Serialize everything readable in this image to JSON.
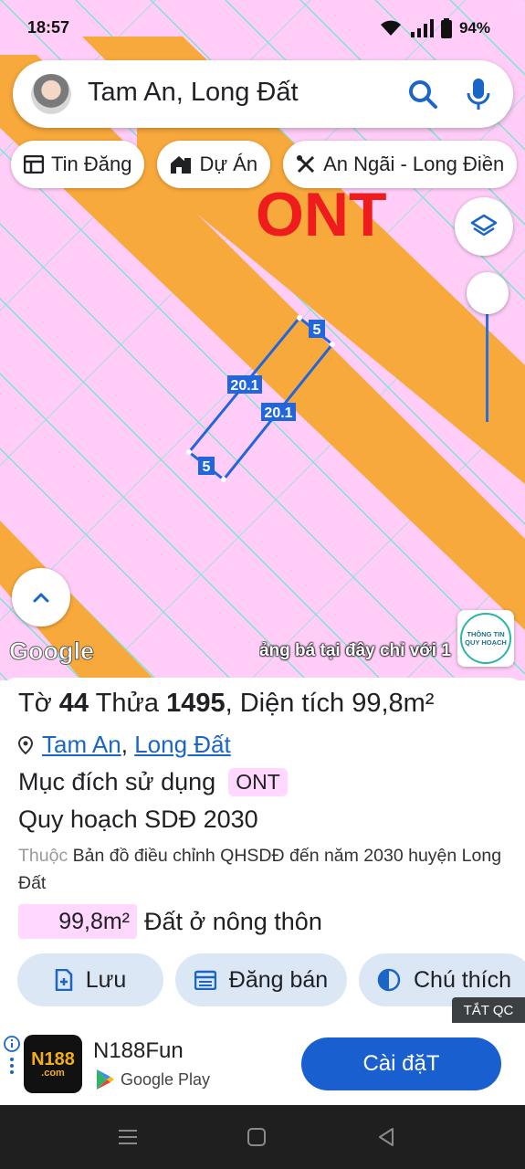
{
  "status_bar": {
    "time": "18:57",
    "battery": "94%"
  },
  "search": {
    "query": "Tam An, Long Đất"
  },
  "chips": [
    {
      "label": "Tin Đăng",
      "icon": "listing-icon"
    },
    {
      "label": "Dự Án",
      "icon": "project-icon"
    },
    {
      "label": "An Ngãi - Long Điền",
      "icon": "tools-icon"
    }
  ],
  "map": {
    "zone_label": "ONT",
    "parcel_edges": {
      "long_side_1": "20.1",
      "long_side_2": "20.1",
      "short_side_1": "5",
      "short_side_2": "5"
    },
    "attribution": "Google",
    "ad_ribbon": "ảng bá tại đây chỉ với 1",
    "planning_badge": "THÔNG TIN QUY HOẠCH",
    "colors": {
      "land": "#ffcdf7",
      "road": "#f8a93b",
      "grid": "#7ee6d0",
      "parcel": "#2266dd"
    }
  },
  "parcel": {
    "sheet_label": "Tờ",
    "sheet_no": "44",
    "plot_label": "Thửa",
    "plot_no": "1495",
    "area_label": ", Diện tích",
    "area": "99,8m²",
    "location": {
      "commune": "Tam An",
      "separator": ",",
      "district": "Long Đất"
    },
    "purpose_label": "Mục đích sử dụng",
    "purpose_code": "ONT",
    "plan_title": "Quy hoạch SDĐ 2030",
    "belongs_prefix": "Thuộc",
    "belongs_to": "Bản đồ điều chỉnh QHSDĐ đến năm 2030 huyện Long Đất",
    "area_value": "99,8m²",
    "area_desc": "Đất ở nông thôn"
  },
  "actions": [
    {
      "label": "Lưu",
      "icon": "save-icon"
    },
    {
      "label": "Đăng bán",
      "icon": "calendar-icon"
    },
    {
      "label": "Chú thích",
      "icon": "contrast-icon"
    }
  ],
  "ad": {
    "close_label": "TẮT QC",
    "app_icon_text": "N188",
    "app_icon_sub": ".com",
    "app_name": "N188Fun",
    "store": "Google Play",
    "install_label": "Cài đặT"
  }
}
